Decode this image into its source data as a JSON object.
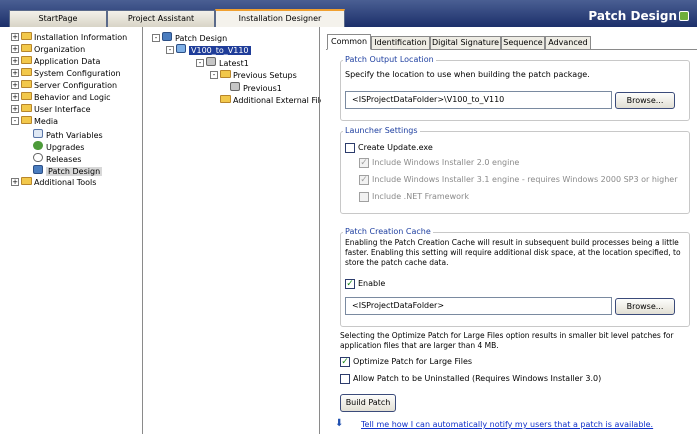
{
  "tabs": [
    {
      "label": "StartPage"
    },
    {
      "label": "Project Assistant"
    },
    {
      "label": "Installation Designer"
    }
  ],
  "window_title": "Patch Design",
  "left_tree": [
    {
      "label": "Installation Information",
      "expander": "+"
    },
    {
      "label": "Organization",
      "expander": "+"
    },
    {
      "label": "Application Data",
      "expander": "+"
    },
    {
      "label": "System Configuration",
      "expander": "+"
    },
    {
      "label": "Server Configuration",
      "expander": "+"
    },
    {
      "label": "Behavior and Logic",
      "expander": "+"
    },
    {
      "label": "User Interface",
      "expander": "+"
    },
    {
      "label": "Media",
      "expander": "-"
    },
    {
      "label": "Path Variables"
    },
    {
      "label": "Upgrades"
    },
    {
      "label": "Releases"
    },
    {
      "label": "Patch Design"
    },
    {
      "label": "Additional Tools",
      "expander": "+"
    }
  ],
  "mid_tree": [
    {
      "label": "Patch Design",
      "expander": "-"
    },
    {
      "label": "V100_to_V110",
      "expander": "-"
    },
    {
      "label": "Latest1",
      "expander": "-"
    },
    {
      "label": "Previous Setups",
      "expander": "-"
    },
    {
      "label": "Previous1"
    },
    {
      "label": "Additional External Files"
    }
  ],
  "right_tabs": [
    {
      "label": "Common"
    },
    {
      "label": "Identification"
    },
    {
      "label": "Digital Signature"
    },
    {
      "label": "Sequence"
    },
    {
      "label": "Advanced"
    }
  ],
  "output": {
    "title": "Patch Output Location",
    "desc": "Specify the location to use when building the patch package.",
    "path": "<ISProjectDataFolder>\\V100_to_V110",
    "browse": "Browse..."
  },
  "launcher": {
    "title": "Launcher Settings",
    "create_update": "Create Update.exe",
    "opt1": "Include Windows Installer 2.0 engine",
    "opt2": "Include Windows Installer 3.1 engine - requires Windows 2000 SP3 or higher",
    "opt3": "Include .NET Framework"
  },
  "cache": {
    "title": "Patch Creation Cache",
    "desc": "Enabling the Patch Creation Cache will result in subsequent build processes being a little faster. Enabling this setting will require additional disk space, at the location specified, to store the patch cache data.",
    "enable": "Enable",
    "path": "<ISProjectDataFolder>",
    "browse": "Browse..."
  },
  "optimize_desc": "Selecting the Optimize Patch for Large Files option results in smaller bit level patches for application files that are larger than 4 MB.",
  "optimize_label": "Optimize Patch for Large Files",
  "uninstall_label": "Allow Patch to be Uninstalled (Requires Windows Installer 3.0)",
  "build_button": "Build Patch",
  "help_link": "Tell me how I can automatically notify my users that a patch is available.",
  "colors": {
    "accent": "#1f3d99",
    "group_title": "#1e3fa0",
    "link": "#1030c8",
    "header": "#1c2f6a"
  }
}
